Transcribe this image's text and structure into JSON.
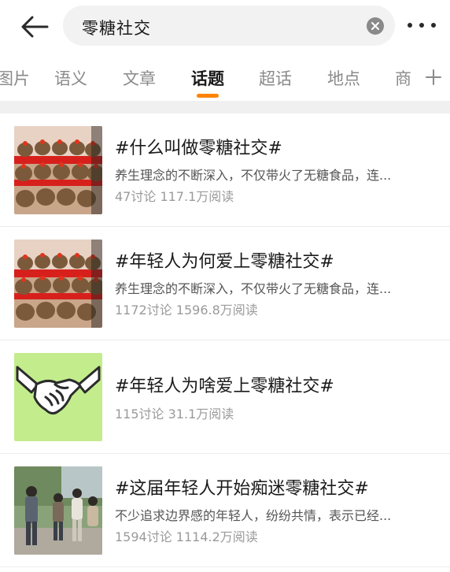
{
  "header": {
    "search_query": "零糖社交",
    "back_icon": "back-arrow-icon",
    "clear_icon": "close-circle-icon",
    "more_icon": "more-dots-icon"
  },
  "tabs": [
    {
      "label": "图片",
      "active": false
    },
    {
      "label": "语义",
      "active": false
    },
    {
      "label": "文章",
      "active": false
    },
    {
      "label": "话题",
      "active": true
    },
    {
      "label": "超话",
      "active": false
    },
    {
      "label": "地点",
      "active": false
    },
    {
      "label": "商",
      "active": false
    }
  ],
  "tab_add_icon": "plus-icon",
  "accent_color": "#ff8200",
  "results": [
    {
      "title": "#什么叫做零糖社交#",
      "desc": "养生理念的不断深入，不仅带火了无糖食品，连...",
      "stats": "47讨论 117.1万阅读",
      "thumb": "capybara-plush-image"
    },
    {
      "title": "#年轻人为何爱上零糖社交#",
      "desc": "养生理念的不断深入，不仅带火了无糖食品，连...",
      "stats": "1172讨论 1596.8万阅读",
      "thumb": "capybara-plush-image"
    },
    {
      "title": "#年轻人为啥爱上零糖社交#",
      "desc": "",
      "stats": "115讨论 31.1万阅读",
      "thumb": "handshake-image"
    },
    {
      "title": "#这届年轻人开始痴迷零糖社交#",
      "desc": "不少追求边界感的年轻人，纷纷共情，表示已经...",
      "stats": "1594讨论 1114.2万阅读",
      "thumb": "people-street-photo"
    }
  ]
}
